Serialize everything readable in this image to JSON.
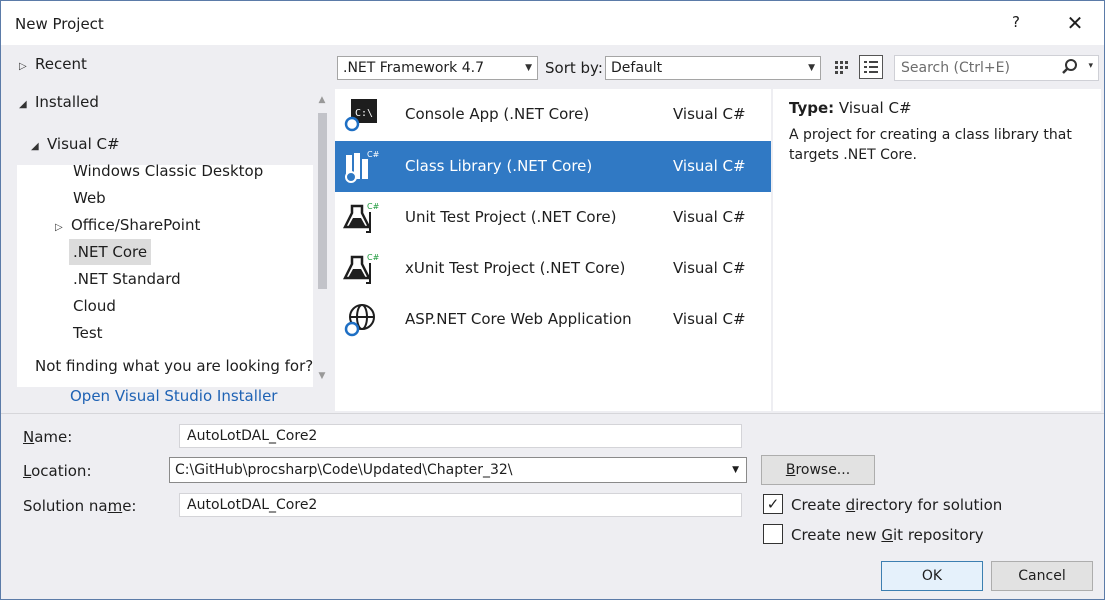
{
  "window": {
    "title": "New Project",
    "help_glyph": "?",
    "close_glyph": "✕"
  },
  "tree": {
    "recent": "Recent",
    "installed": "Installed",
    "visual_csharp": "Visual C#",
    "items": [
      "Windows Classic Desktop",
      "Web",
      "Office/SharePoint",
      ".NET Core",
      ".NET Standard",
      "Cloud",
      "Test"
    ],
    "selected_item": ".NET Core",
    "not_finding": "Not finding what you are looking for?",
    "installer_link": "Open Visual Studio Installer"
  },
  "toolbar": {
    "framework": ".NET Framework 4.7",
    "sort_label": "Sort by:",
    "sort_value": "Default",
    "search_placeholder": "Search (Ctrl+E)"
  },
  "templates": [
    {
      "name": "Console App (.NET Core)",
      "lang": "Visual C#",
      "icon": "console-app-icon"
    },
    {
      "name": "Class Library (.NET Core)",
      "lang": "Visual C#",
      "icon": "class-library-icon",
      "selected": true
    },
    {
      "name": "Unit Test Project (.NET Core)",
      "lang": "Visual C#",
      "icon": "unit-test-icon"
    },
    {
      "name": "xUnit Test Project (.NET Core)",
      "lang": "Visual C#",
      "icon": "xunit-test-icon"
    },
    {
      "name": "ASP.NET Core Web Application",
      "lang": "Visual C#",
      "icon": "web-application-icon"
    }
  ],
  "description": {
    "type_key": "Type:",
    "type_value": "Visual C#",
    "text": "A project for creating a class library that targets .NET Core."
  },
  "form": {
    "name_label": "Name:",
    "name_value": "AutoLotDAL_Core2",
    "location_label": "Location:",
    "location_value": "C:\\GitHub\\procsharp\\Code\\Updated\\Chapter_32\\",
    "solution_label": "Solution name:",
    "solution_value": "AutoLotDAL_Core2",
    "browse": "Browse...",
    "create_directory": "Create directory for solution",
    "create_directory_checked": true,
    "create_git": "Create new Git repository",
    "create_git_checked": false,
    "ok": "OK",
    "cancel": "Cancel"
  },
  "colors": {
    "selection": "#3079c4",
    "link": "#1e62b4",
    "panel": "#eeeef2"
  }
}
